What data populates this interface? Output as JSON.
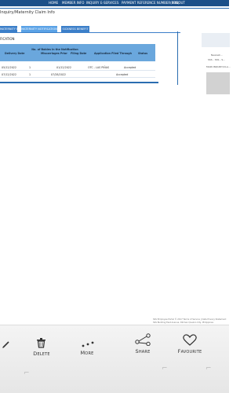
{
  "topnav": {
    "items": [
      "HOME",
      "MEMBER INFO",
      "INQUIRY",
      "E-SERVICES",
      "PAYMENT REFERENCE NUMBER(PRN)",
      "LOGOUT"
    ]
  },
  "page_title": "Inquiry/Maternity Claim Info",
  "tabs": [
    "MATERNITY BENEFIT",
    "MATERNITY NOTIFICATION",
    "SICKNESS BENEFIT"
  ],
  "section_title": "FICATION",
  "table": {
    "headers": {
      "delivery_date": "Delivery Date",
      "no_of_babies": "No. of Babies in the Notification",
      "miscarriages": "Miscarriages Prior",
      "filing_date": "Filing Date",
      "application_filed_through": "Application Filed Through",
      "status": "Status"
    },
    "rows": [
      [
        "05/12/2022",
        "1",
        "",
        "01/12/2022",
        "OTC - LAS PIÑAS",
        "Accepted"
      ],
      [
        "07/12/2022",
        "1",
        "",
        "07/28/2022",
        "",
        "Accepted"
      ]
    ]
  },
  "side_panel": {
    "lines": [
      "Nearest...",
      "SSS - SSS - S...",
      "MAIN INQUIRY/CLA..."
    ]
  },
  "footer": {
    "line1": "SSS Employee Portal © 2017 Terms of Service | Data Privacy Statement",
    "line2": "SSS Building East Avenue, Diliman Quezon City, Philippines"
  },
  "actions": {
    "edit": "",
    "delete": "Delete",
    "more": "More",
    "share": "Share",
    "favourite": "Favourite"
  }
}
